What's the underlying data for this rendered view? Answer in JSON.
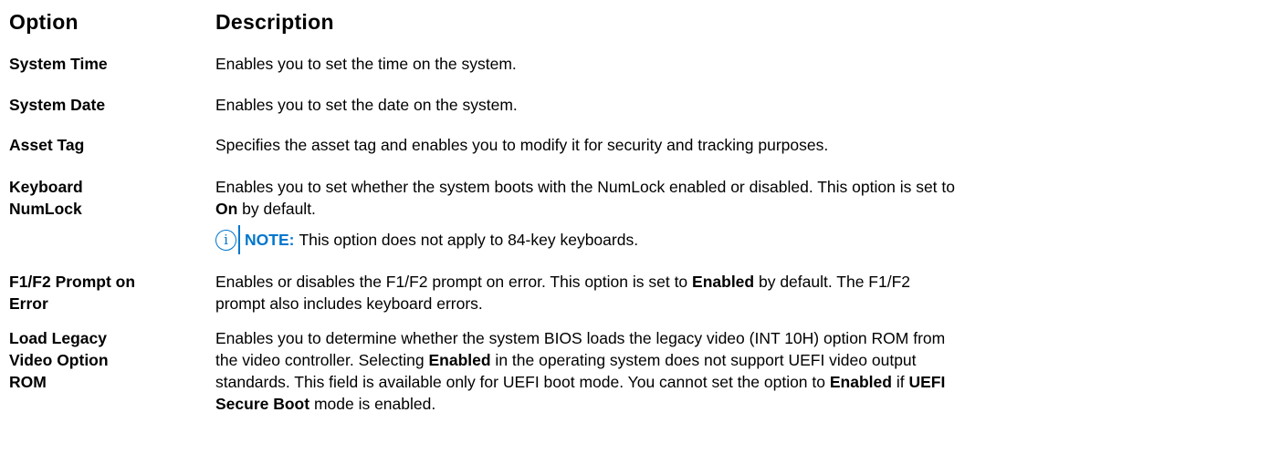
{
  "header": {
    "option": "Option",
    "description": "Description"
  },
  "rows": [
    {
      "option": "System Time",
      "description": "Enables you to set the time on the system."
    },
    {
      "option": "System Date",
      "description": "Enables you to set the date on the system."
    },
    {
      "option": "Asset Tag",
      "description": "Specifies the asset tag and enables you to modify it for security and tracking purposes."
    },
    {
      "option_line1": "Keyboard",
      "option_line2": "NumLock",
      "desc_line1": "Enables you to set whether the system boots with the NumLock enabled or disabled. This option is set to",
      "desc_bold": "On",
      "desc_tail": " by default.",
      "note_label": "NOTE:",
      "note_text": "This option does not apply to 84-key keyboards.",
      "note_icon": "info-icon"
    },
    {
      "option_line1": "F1/F2 Prompt on",
      "option_line2": "Error",
      "desc_a": "Enables or disables the F1/F2 prompt on error. This option is set to ",
      "desc_bold": "Enabled",
      "desc_b": " by default. The F1/F2",
      "desc_line2": "prompt also includes keyboard errors."
    },
    {
      "option_line1": "Load Legacy",
      "option_line2": "Video Option",
      "option_line3": "ROM",
      "desc_line1": "Enables you to determine whether the system BIOS loads the legacy video (INT 10H) option ROM from",
      "desc_line2a": "the video controller. Selecting ",
      "desc_bold1": "Enabled",
      "desc_line2b": " in the operating system does not support UEFI video output",
      "desc_line3a": "standards. This field is available only for UEFI boot mode. You cannot set the option to ",
      "desc_bold2": "Enabled",
      "desc_line3b": " if ",
      "desc_bold3": "UEFI",
      "desc_bold4": "Secure Boot",
      "desc_line4b": " mode is enabled."
    }
  ],
  "colors": {
    "note_accent": "#0076ce",
    "text": "#000000",
    "background": "#ffffff"
  }
}
